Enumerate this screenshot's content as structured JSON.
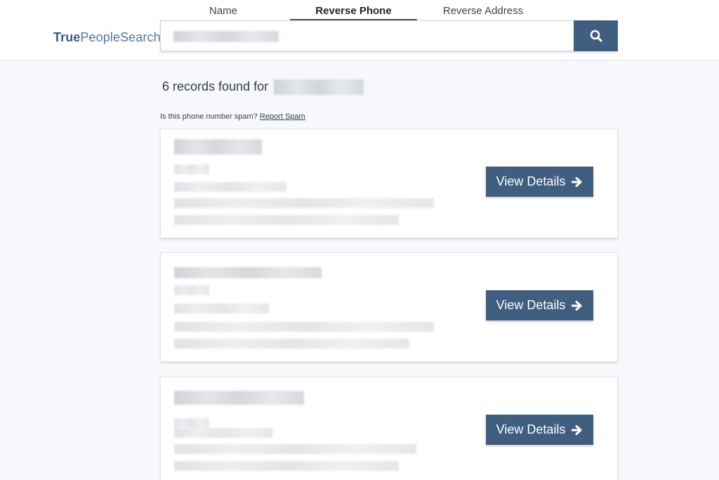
{
  "brand": {
    "bold": "True",
    "rest": "PeopleSearch"
  },
  "tabs": [
    {
      "label": "Name",
      "active": false
    },
    {
      "label": "Reverse Phone",
      "active": true
    },
    {
      "label": "Reverse Address",
      "active": false
    }
  ],
  "search": {
    "value": "",
    "button_icon": "search-icon"
  },
  "results": {
    "count_text": "6 records found for",
    "spam_question": "Is this phone number spam?",
    "spam_link": "Report Spam"
  },
  "cards": [
    {
      "button_label": "View Details",
      "button_icon": "arrow-right-icon"
    },
    {
      "button_label": "View Details",
      "button_icon": "arrow-right-icon"
    },
    {
      "button_label": "View Details",
      "button_icon": "arrow-right-icon"
    }
  ],
  "colors": {
    "accent": "#405e80",
    "brand": "#52779e",
    "background": "#f6f8fb"
  }
}
